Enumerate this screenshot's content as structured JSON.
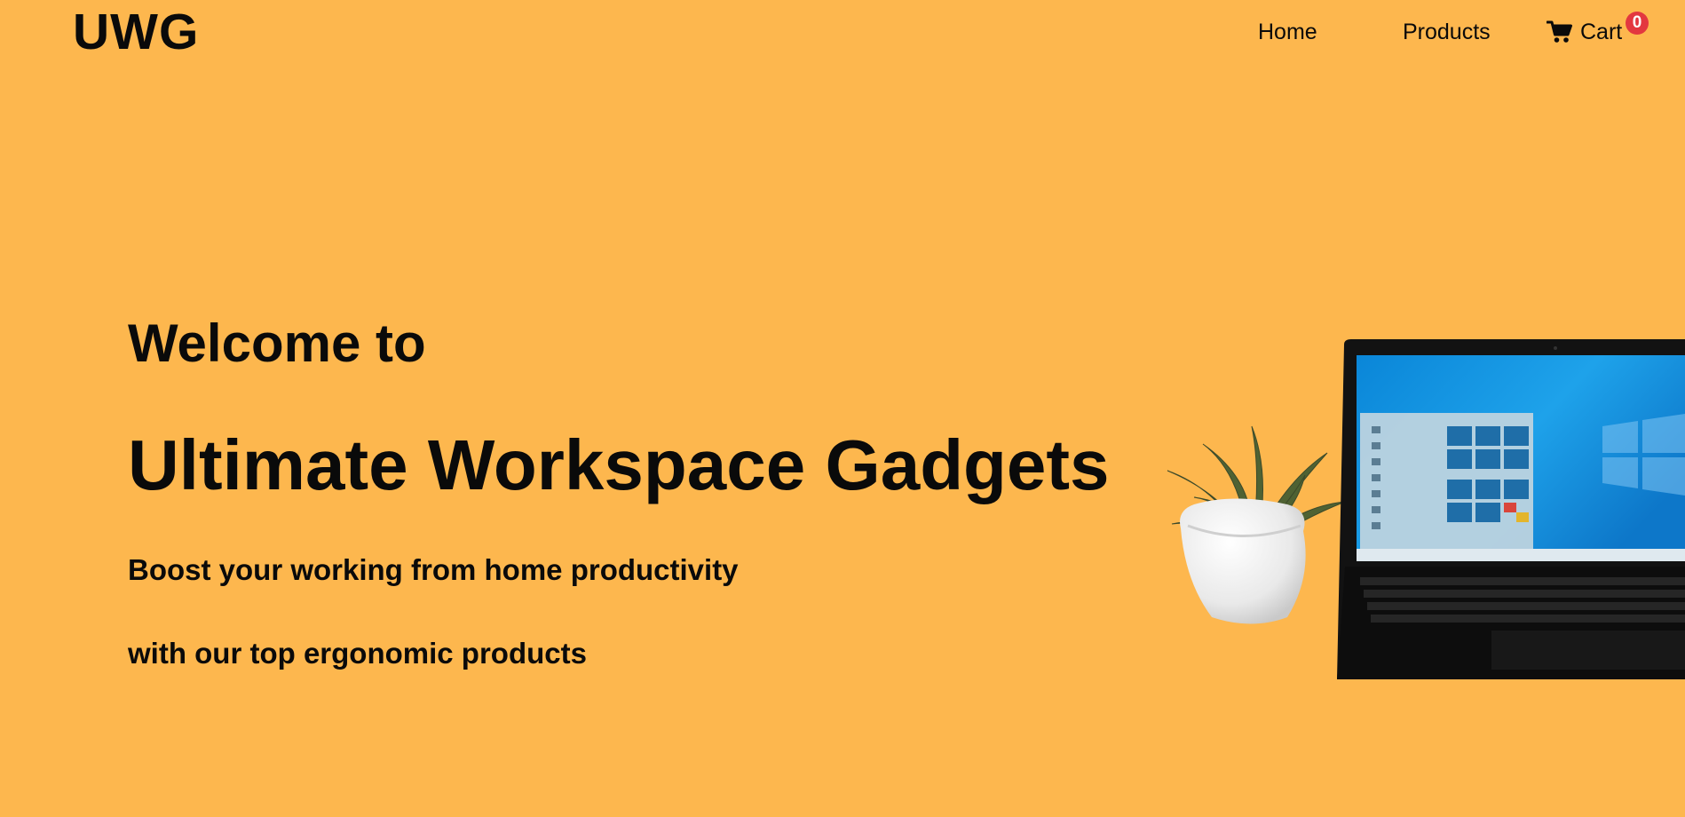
{
  "brand": {
    "logo": "UWG"
  },
  "nav": {
    "home": "Home",
    "products": "Products",
    "cart_label": "Cart",
    "cart_count": "0",
    "cart_icon": "shopping-cart-icon"
  },
  "hero": {
    "welcome": "Welcome to",
    "headline": "Ultimate Workspace Gadgets",
    "tagline_line1": "Boost your working from home productivity",
    "tagline_line2": "with our top ergonomic products"
  },
  "colors": {
    "background": "#FDB74E",
    "badge": "#e3373f",
    "text": "#0a0a0a"
  }
}
